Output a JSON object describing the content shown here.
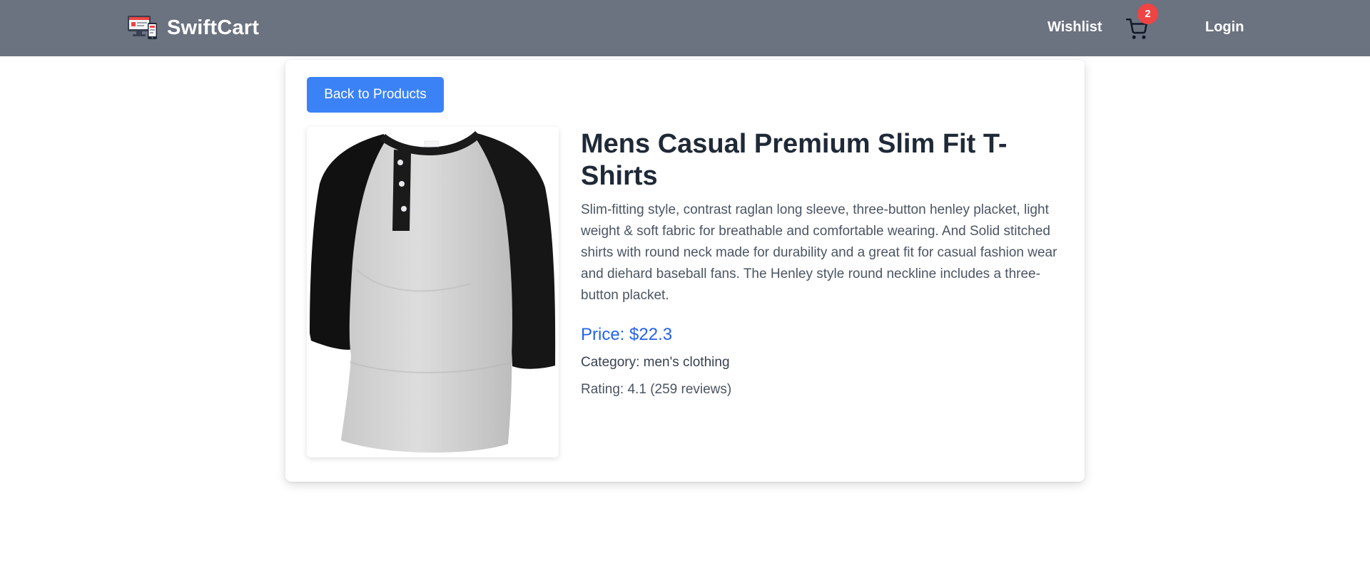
{
  "header": {
    "brand": "SwiftCart",
    "wishlist_label": "Wishlist",
    "cart_count": "2",
    "login_label": "Login",
    "colors": {
      "background": "#6b7280",
      "badge": "#ef4444"
    }
  },
  "main": {
    "back_button_label": "Back to Products",
    "product": {
      "title": "Mens Casual Premium Slim Fit T-Shirts",
      "description": "Slim-fitting style, contrast raglan long sleeve, three-button henley placket, light weight & soft fabric for breathable and comfortable wearing. And Solid stitched shirts with round neck made for durability and a great fit for casual fashion wear and diehard baseball fans. The Henley style round neckline includes a three-button placket.",
      "price_label": "Price:",
      "price": "$22.3",
      "category_label": "Category:",
      "category": "men's clothing",
      "rating_label": "Rating:",
      "rating": "4.1",
      "reviews": "(259 reviews)"
    },
    "colors": {
      "accent": "#3b82f6",
      "price": "#2563eb"
    }
  },
  "icons": {
    "brand": "shop-devices-logo-icon",
    "cart": "shopping-cart-icon"
  }
}
